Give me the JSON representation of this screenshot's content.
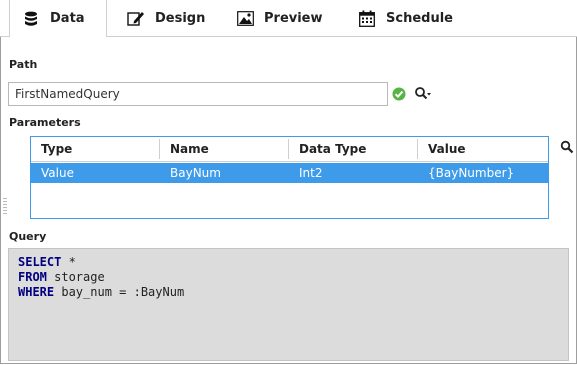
{
  "tabs": [
    {
      "label": "Data",
      "icon": "database-icon",
      "active": true
    },
    {
      "label": "Design",
      "icon": "design-edit-icon",
      "active": false
    },
    {
      "label": "Preview",
      "icon": "image-preview-icon",
      "active": false
    },
    {
      "label": "Schedule",
      "icon": "calendar-icon",
      "active": false
    }
  ],
  "path": {
    "label": "Path",
    "value": "FirstNamedQuery"
  },
  "parameters": {
    "label": "Parameters",
    "columns": [
      "Type",
      "Name",
      "Data Type",
      "Value"
    ],
    "rows": [
      {
        "type": "Value",
        "name": "BayNum",
        "data_type": "Int2",
        "value": "{BayNumber}"
      }
    ]
  },
  "query": {
    "label": "Query",
    "lines": [
      {
        "keyword": "SELECT",
        "rest": " *"
      },
      {
        "keyword": "FROM",
        "rest": " storage"
      },
      {
        "keyword": "WHERE",
        "rest": " bay_num = :BayNum"
      }
    ]
  },
  "colors": {
    "selection": "#3d9be9",
    "ok_green": "#56b442",
    "keyword": "#000080",
    "query_bg": "#dcdcdc"
  }
}
